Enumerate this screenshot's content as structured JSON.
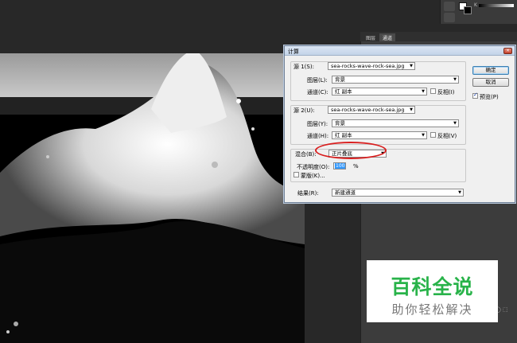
{
  "dialog": {
    "title": "计算",
    "close_symbol": "×",
    "source1": {
      "label": "源 1(S):",
      "file": "sea-rocks-wave-rock-sea.jpg",
      "layer_label": "图层(L):",
      "layer": "背景",
      "channel_label": "通道(C):",
      "channel": "红 副本",
      "invert_label": "反相(I)",
      "invert_checked": false
    },
    "source2": {
      "label": "源 2(U):",
      "file": "sea-rocks-wave-rock-sea.jpg",
      "layer_label": "图层(Y):",
      "layer": "背景",
      "channel_label": "通道(H):",
      "channel": "红 副本",
      "invert_label": "反相(V)",
      "invert_checked": false
    },
    "blending": {
      "label": "混合(B):",
      "mode": "正片叠底",
      "opacity_label": "不透明度(O):",
      "opacity_value": "100",
      "opacity_unit": "%",
      "mask_label": "蒙版(K)...",
      "mask_checked": false
    },
    "result": {
      "label": "结果(R):",
      "value": "新建通道"
    },
    "ok_label": "确定",
    "cancel_label": "取消",
    "preview_label": "预览(P)",
    "preview_checked": true
  },
  "panel": {
    "tabs": [
      "图层",
      "通道"
    ],
    "active_tab": "通道",
    "bottom_glyphs": "◯ ⬚"
  },
  "toolbar": {
    "mini_label": "K"
  },
  "watermark": {
    "title": "百科全说",
    "subtitle": "助你轻松解决"
  },
  "colors": {
    "highlight_ring": "#d91f1f",
    "watermark_green": "#29b34a",
    "selection_blue": "#3399ff"
  }
}
